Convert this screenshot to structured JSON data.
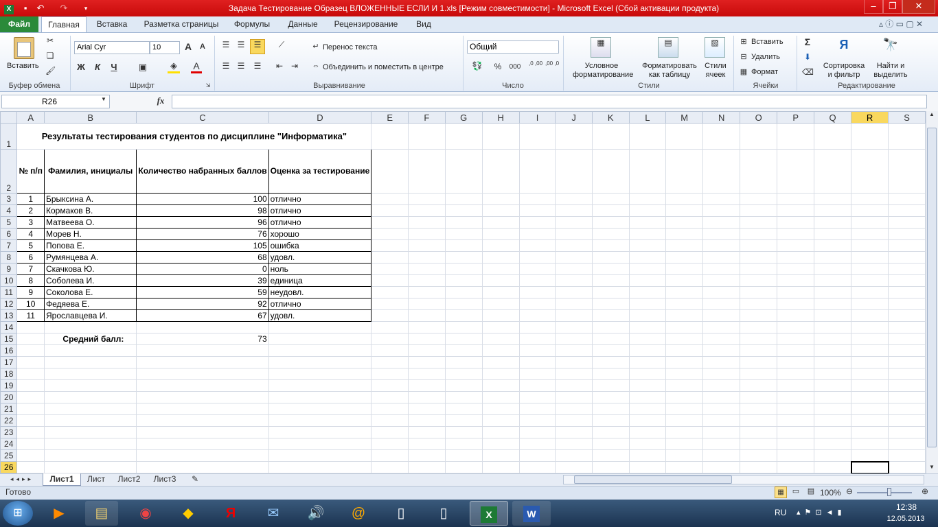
{
  "window": {
    "title": "Задача Тестирование Образец ВЛОЖЕННЫЕ  ЕСЛИ И 1.xls  [Режим совместимости]  -  Microsoft Excel (Сбой активации продукта)"
  },
  "tabs": {
    "file": "Файл",
    "items": [
      "Главная",
      "Вставка",
      "Разметка страницы",
      "Формулы",
      "Данные",
      "Рецензирование",
      "Вид"
    ]
  },
  "ribbon": {
    "clipboard": {
      "paste": "Вставить",
      "group": "Буфер обмена"
    },
    "font": {
      "name": "Arial Cyr",
      "size": "10",
      "bold": "Ж",
      "italic": "К",
      "underline": "Ч",
      "grow": "A",
      "shrink": "A",
      "color": "A",
      "group": "Шрифт"
    },
    "alignment": {
      "wrap": "Перенос текста",
      "merge": "Объединить и поместить в центре",
      "group": "Выравнивание"
    },
    "number": {
      "format": "Общий",
      "percent": "%",
      "thousands": "000",
      "inc_dec": ",0 ,00",
      "dec_dec": ",00 ,0",
      "group": "Число"
    },
    "styles": {
      "conditional": [
        "Условное",
        "форматирование"
      ],
      "as_table": [
        "Форматировать",
        "как таблицу"
      ],
      "cell_styles": [
        "Стили",
        "ячеек"
      ],
      "group": "Стили"
    },
    "cells": {
      "insert": "Вставить",
      "delete": "Удалить",
      "format": "Формат",
      "group": "Ячейки"
    },
    "editing": {
      "sort": [
        "Сортировка",
        "и фильтр"
      ],
      "find": [
        "Найти и",
        "выделить"
      ],
      "group": "Редактирование",
      "sigma": "Σ"
    }
  },
  "formula_bar": {
    "name_box": "R26",
    "fx": "fx",
    "value": ""
  },
  "columns": [
    "A",
    "B",
    "C",
    "D",
    "E",
    "F",
    "G",
    "H",
    "I",
    "J",
    "K",
    "L",
    "M",
    "N",
    "O",
    "P",
    "Q",
    "R",
    "S"
  ],
  "selected_column": "R",
  "selected_row": "26",
  "sheet": {
    "title": "Результаты тестирования студентов по дисциплине \"Информатика\"",
    "headers": [
      "№ п/п",
      "Фамилия, инициалы",
      "Количество набранных баллов",
      "Оценка за тестирование"
    ],
    "rows": [
      [
        "1",
        "Брыксина А.",
        "100",
        "отлично"
      ],
      [
        "2",
        "Кормаков В.",
        "98",
        "отлично"
      ],
      [
        "3",
        "Матвеева О.",
        "96",
        "отлично"
      ],
      [
        "4",
        "Морев Н.",
        "76",
        "хорошо"
      ],
      [
        "5",
        "Попова Е.",
        "105",
        "ошибка"
      ],
      [
        "6",
        "Румянцева А.",
        "68",
        "удовл."
      ],
      [
        "7",
        "Скачкова Ю.",
        "0",
        "ноль"
      ],
      [
        "8",
        "Соболева И.",
        "39",
        "единица"
      ],
      [
        "9",
        "Соколова Е.",
        "59",
        "неудовл."
      ],
      [
        "10",
        "Федяева Е.",
        "92",
        "отлично"
      ],
      [
        "11",
        "Ярославцева И.",
        "67",
        "удовл."
      ]
    ],
    "average_label": "Средний балл:",
    "average_value": "73",
    "row_numbers": [
      "1",
      "2",
      "3",
      "4",
      "5",
      "6",
      "7",
      "8",
      "9",
      "10",
      "11",
      "12",
      "13",
      "14",
      "15",
      "16",
      "17",
      "18",
      "19",
      "20",
      "21",
      "22",
      "23",
      "24",
      "25",
      "26"
    ]
  },
  "sheet_tabs": [
    "Лист1",
    "Лист",
    "Лист2",
    "Лист3"
  ],
  "active_sheet": "Лист1",
  "status": {
    "ready": "Готово",
    "zoom": "100%"
  },
  "taskbar": {
    "lang": "RU",
    "time": "12:38",
    "date": "12.05.2013"
  }
}
